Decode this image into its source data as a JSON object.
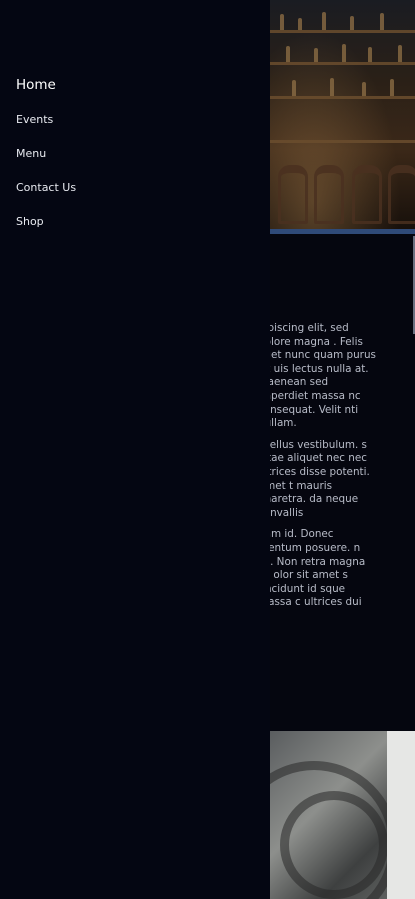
{
  "nav": {
    "items": [
      {
        "label": "Home",
        "active": true
      },
      {
        "label": "Events",
        "active": false
      },
      {
        "label": "Menu",
        "active": false
      },
      {
        "label": "Contact Us",
        "active": false
      },
      {
        "label": "Shop",
        "active": false
      }
    ]
  },
  "article": {
    "paragraphs": [
      "dipiscing elit, sed dolore magna . Felis eget nunc quam purus sit uis lectus nulla at. o aenean sed imperdiet massa nc consequat. Velit nti nullam.",
      "asellus vestibulum. s vitae aliquet nec nec ultrices disse potenti. Amet t mauris pharetra. da neque convallis",
      "uam id. Donec mentum posuere. n ac. Non retra magna ac olor sit amet s tincidunt id sque massa c ultrices dui"
    ]
  },
  "colors": {
    "background": "#05060f",
    "drawer": "#040612",
    "nav_text": "#ffffff",
    "hero_accent": "#2f4a78"
  }
}
